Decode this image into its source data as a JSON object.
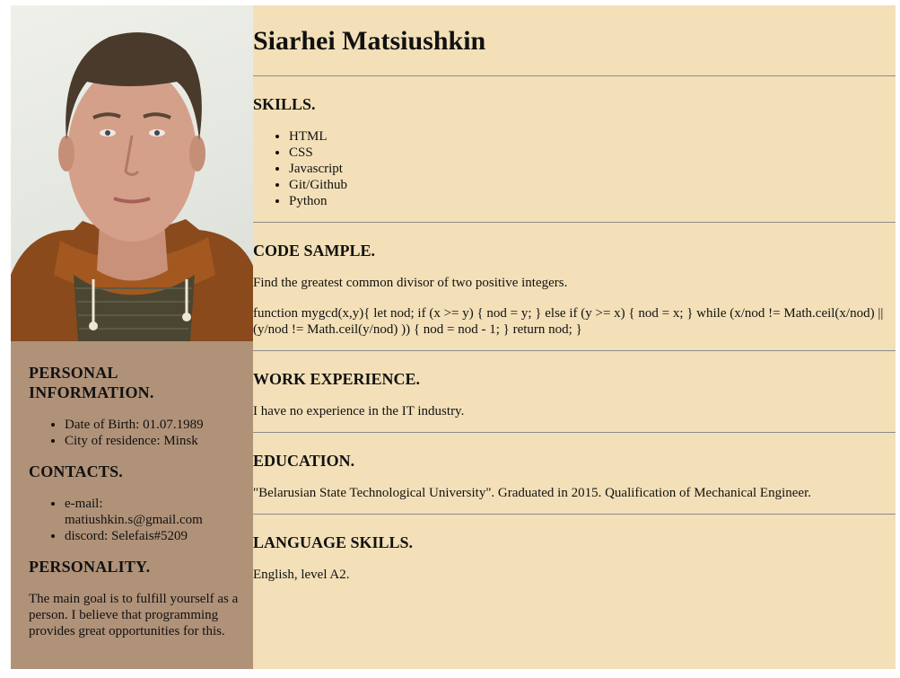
{
  "name": "Siarhei Matsiushkin",
  "personal": {
    "heading": "PERSONAL INFORMATION.",
    "items": [
      "Date of Birth: 01.07.1989",
      "City of residence: Minsk"
    ]
  },
  "contacts": {
    "heading": "CONTACTS.",
    "items": [
      "e-mail: matiushkin.s@gmail.com",
      "discord: Selefais#5209"
    ]
  },
  "personality": {
    "heading": "PERSONALITY.",
    "text": "The main goal is to fulfill yourself as a person. I believe that programming provides great opportunities for this."
  },
  "skills": {
    "heading": "SKILLS.",
    "items": [
      "HTML",
      "CSS",
      "Javascript",
      "Git/Github",
      "Python"
    ]
  },
  "code_sample": {
    "heading": "CODE SAMPLE.",
    "description": "Find the greatest common divisor of two positive integers.",
    "code": "function mygcd(x,y){ let nod; if (x >= y) { nod = y; } else if (y >= x) { nod = x; } while (x/nod != Math.ceil(x/nod) || (y/nod != Math.ceil(y/nod) )) { nod = nod - 1; } return nod; }"
  },
  "work": {
    "heading": "WORK EXPERIENCE.",
    "text": "I have no experience in the IT industry."
  },
  "education": {
    "heading": "EDUCATION.",
    "text": "\"Belarusian State Technological University\". Graduated in 2015. Qualification of Mechanical Engineer."
  },
  "languages": {
    "heading": "LANGUAGE SKILLS.",
    "text": "English, level A2."
  }
}
